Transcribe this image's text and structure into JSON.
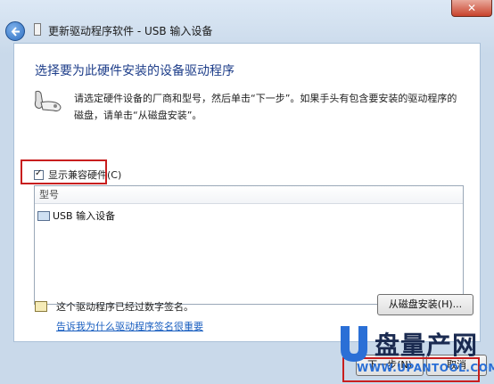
{
  "window": {
    "title": "更新驱动程序软件 - USB 输入设备",
    "close_glyph": "✕"
  },
  "main": {
    "heading": "选择要为此硬件安装的设备驱动程序",
    "instruction": "请选定硬件设备的厂商和型号，然后单击“下一步”。如果手头有包含要安装的驱动程序的磁盘，请单击“从磁盘安装”。",
    "show_compatible_label": "显示兼容硬件(C)",
    "show_compatible_checked": true,
    "list": {
      "header": "型号",
      "items": [
        {
          "label": "USB 输入设备",
          "selected": true
        }
      ]
    },
    "signed_text": "这个驱动程序已经过数字签名。",
    "why_link": "告诉我为什么驱动程序签名很重要",
    "have_disk_button": "从磁盘安装(H)..."
  },
  "footer": {
    "next_button": "下一步(N)",
    "cancel_button": "取消"
  },
  "watermark": {
    "cn": "盘量产网",
    "url": "WWW.UPANTOOL.COM"
  },
  "colors": {
    "accent": "#1e3e8a",
    "highlight": "#c81e1e",
    "link": "#1a5fc0"
  },
  "icons": [
    "back-arrow-icon",
    "device-icon",
    "gamepad-icon",
    "monitor-icon",
    "certificate-icon",
    "close-icon"
  ]
}
